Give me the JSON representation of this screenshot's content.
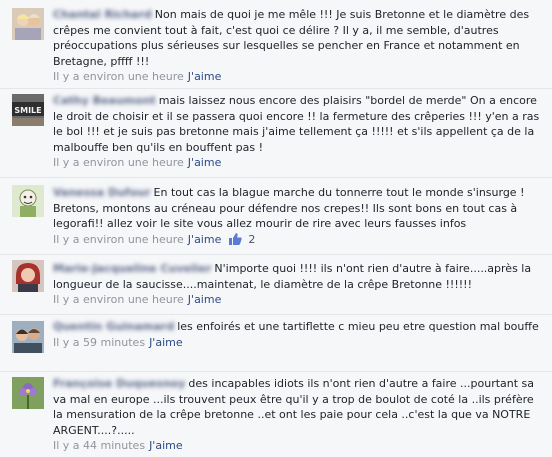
{
  "comments": [
    {
      "author": "Chantal Richard",
      "text": "Non mais de quoi je me mêle !!! Je suis Bretonne et le diamètre des crêpes me convient tout à fait, c'est quoi ce délire ? Il y a, il me semble, d'autres préoccupations plus sérieuses sur lesquelles se pencher en France et notamment en Bretagne, pffff !!!",
      "time": "Il y a environ une heure",
      "like_label": "J'aime",
      "avatar": "two-people-photo",
      "avatar_color": "#c9b9a6"
    },
    {
      "author": "Cathy Beaumont",
      "text": "mais laissez nous encore des plaisirs \"bordel de merde\" On a encore le droit de choisir et il se passera quoi encore !! la fermeture des crêperies !!! y'en a ras le bol !!! et je suis pas bretonne mais j'aime tellement ça !!!!! et s'ils appellent ça de la malbouffe ben qu'ils en bouffent pas !",
      "time": "Il y a environ une heure",
      "like_label": "J'aime",
      "avatar": "smile-sign-photo",
      "avatar_color": "#5b5b5b"
    },
    {
      "author": "Vanessa Dufour",
      "text": "En tout cas la blague marche du tonnerre tout le monde s'insurge ! Bretons, montons au créneau pour défendre nos crepes!! Ils sont bons en tout cas à legorafi!! allez voir le site vous allez mourir de rire avec leurs fausses infos",
      "time": "Il y a environ une heure",
      "like_label": "J'aime",
      "like_count": "2",
      "avatar": "cartoon-character",
      "avatar_color": "#bfd7a8"
    },
    {
      "author": "Marie-Jacqueline Cuvelier",
      "text": "N'importe quoi !!!! ils n'ont rien d'autre à faire.....après la longueur de la saucisse....maintenat, le diamètre de la crêpe Bretonne !!!!!!",
      "time": "Il y a environ une heure",
      "like_label": "J'aime",
      "avatar": "woman-photo",
      "avatar_color": "#b7423a"
    },
    {
      "author": "Quentin Guinamard",
      "text": "les enfoirés et une tartiflette c mieu peu etre question mal bouffe",
      "time": "Il y a 59 minutes",
      "like_label": "J'aime",
      "avatar": "couple-photo",
      "avatar_color": "#7a8a99"
    },
    {
      "author": "Françoise Duquesnoy",
      "text": "des incapables idiots ils n'ont rien d'autre a faire ...pourtant sa va mal en europe ...ils trouvent peux être qu'il y a trop de boulot de coté la ..ils préfère la mensuration de la crêpe bretonne ..et ont les paie pour cela ..c'est la que va NOTRE ARGENT....?.....",
      "time": "Il y a 44 minutes",
      "like_label": "J'aime",
      "avatar": "flower-photo",
      "avatar_color": "#6d8f4e"
    }
  ]
}
